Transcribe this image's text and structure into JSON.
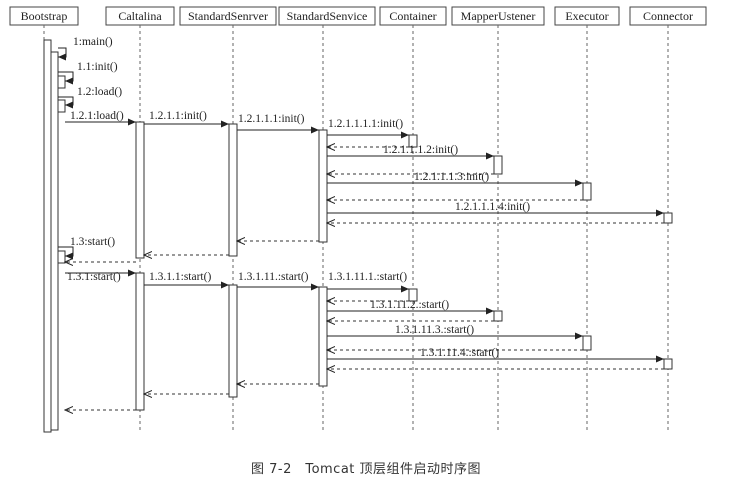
{
  "participants": [
    {
      "id": "bootstrap",
      "name": "Bootstrap"
    },
    {
      "id": "caltalina",
      "name": "Caltalina"
    },
    {
      "id": "standard-senrver",
      "name": "StandardSenrver"
    },
    {
      "id": "standard-senvice",
      "name": "StandardSenvice"
    },
    {
      "id": "container",
      "name": "Container"
    },
    {
      "id": "mapper-ustener",
      "name": "MapperUstener"
    },
    {
      "id": "executor",
      "name": "Executor"
    },
    {
      "id": "connector",
      "name": "Connector"
    }
  ],
  "messages": [
    {
      "id": "m1",
      "label": "1:main()",
      "from": "bootstrap",
      "to": "bootstrap",
      "kind": "self"
    },
    {
      "id": "m2",
      "label": "1.1:init()",
      "from": "bootstrap",
      "to": "bootstrap",
      "kind": "self"
    },
    {
      "id": "m3",
      "label": "1.2:load()",
      "from": "bootstrap",
      "to": "bootstrap",
      "kind": "self"
    },
    {
      "id": "m4",
      "label": "1.2.1:load()",
      "from": "bootstrap",
      "to": "caltalina",
      "kind": "call"
    },
    {
      "id": "m5",
      "label": "1.2.1.1:init()",
      "from": "caltalina",
      "to": "standard-senrver",
      "kind": "call"
    },
    {
      "id": "m6",
      "label": "1.2.1.1.1:init()",
      "from": "standard-senrver",
      "to": "standard-senvice",
      "kind": "call"
    },
    {
      "id": "m7",
      "label": "1.2.1.1.1.1:init()",
      "from": "standard-senvice",
      "to": "container",
      "kind": "call"
    },
    {
      "id": "m8",
      "label": "1.2.1.1.1.2:init()",
      "from": "standard-senvice",
      "to": "mapper-ustener",
      "kind": "call"
    },
    {
      "id": "m9",
      "label": "1.2.1.1.1.3:init()",
      "from": "standard-senvice",
      "to": "executor",
      "kind": "call"
    },
    {
      "id": "m10",
      "label": "1.2.1.1.1.4:init()",
      "from": "standard-senvice",
      "to": "connector",
      "kind": "call"
    },
    {
      "id": "m11",
      "label": "1.3:start()",
      "from": "bootstrap",
      "to": "bootstrap",
      "kind": "self"
    },
    {
      "id": "m12",
      "label": "1.3.1:start()",
      "from": "bootstrap",
      "to": "caltalina",
      "kind": "call"
    },
    {
      "id": "m13",
      "label": "1.3.1.1:start()",
      "from": "caltalina",
      "to": "standard-senrver",
      "kind": "call"
    },
    {
      "id": "m14",
      "label": "1.3.1.11.:start()",
      "from": "standard-senrver",
      "to": "standard-senvice",
      "kind": "call"
    },
    {
      "id": "m15",
      "label": "1.3.1.11.1.:start()",
      "from": "standard-senvice",
      "to": "container",
      "kind": "call"
    },
    {
      "id": "m16",
      "label": "1.3.1.11.2.:start()",
      "from": "standard-senvice",
      "to": "mapper-ustener",
      "kind": "call"
    },
    {
      "id": "m17",
      "label": "1.3.1.11.3.:start()",
      "from": "standard-senvice",
      "to": "executor",
      "kind": "call"
    },
    {
      "id": "m18",
      "label": "1.3.1.11.4.:start()",
      "from": "standard-senvice",
      "to": "connector",
      "kind": "call"
    }
  ],
  "caption": "图 7-2　Tomcat 顶层组件启动时序图"
}
